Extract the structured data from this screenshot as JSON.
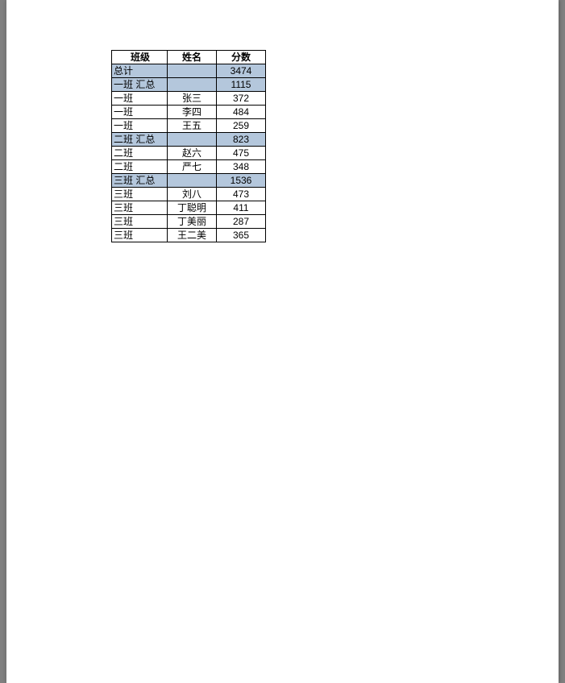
{
  "table": {
    "headers": {
      "class": "班级",
      "name": "姓名",
      "score": "分数"
    },
    "rows": [
      {
        "type": "summary",
        "class": "总计",
        "name": "",
        "score": "3474"
      },
      {
        "type": "summary",
        "class": "一班 汇总",
        "name": "",
        "score": "1115"
      },
      {
        "type": "data",
        "class": "一班",
        "name": "张三",
        "score": "372"
      },
      {
        "type": "data",
        "class": "一班",
        "name": "李四",
        "score": "484"
      },
      {
        "type": "data",
        "class": "一班",
        "name": "王五",
        "score": "259"
      },
      {
        "type": "summary",
        "class": "二班 汇总",
        "name": "",
        "score": "823"
      },
      {
        "type": "data",
        "class": "二班",
        "name": "赵六",
        "score": "475"
      },
      {
        "type": "data",
        "class": "二班",
        "name": "严七",
        "score": "348"
      },
      {
        "type": "summary",
        "class": "三班 汇总",
        "name": "",
        "score": "1536"
      },
      {
        "type": "data",
        "class": "三班",
        "name": "刘八",
        "score": "473"
      },
      {
        "type": "data",
        "class": "三班",
        "name": "丁聪明",
        "score": "411"
      },
      {
        "type": "data",
        "class": "三班",
        "name": "丁美丽",
        "score": "287"
      },
      {
        "type": "data",
        "class": "三班",
        "name": "王二美",
        "score": "365"
      }
    ]
  }
}
